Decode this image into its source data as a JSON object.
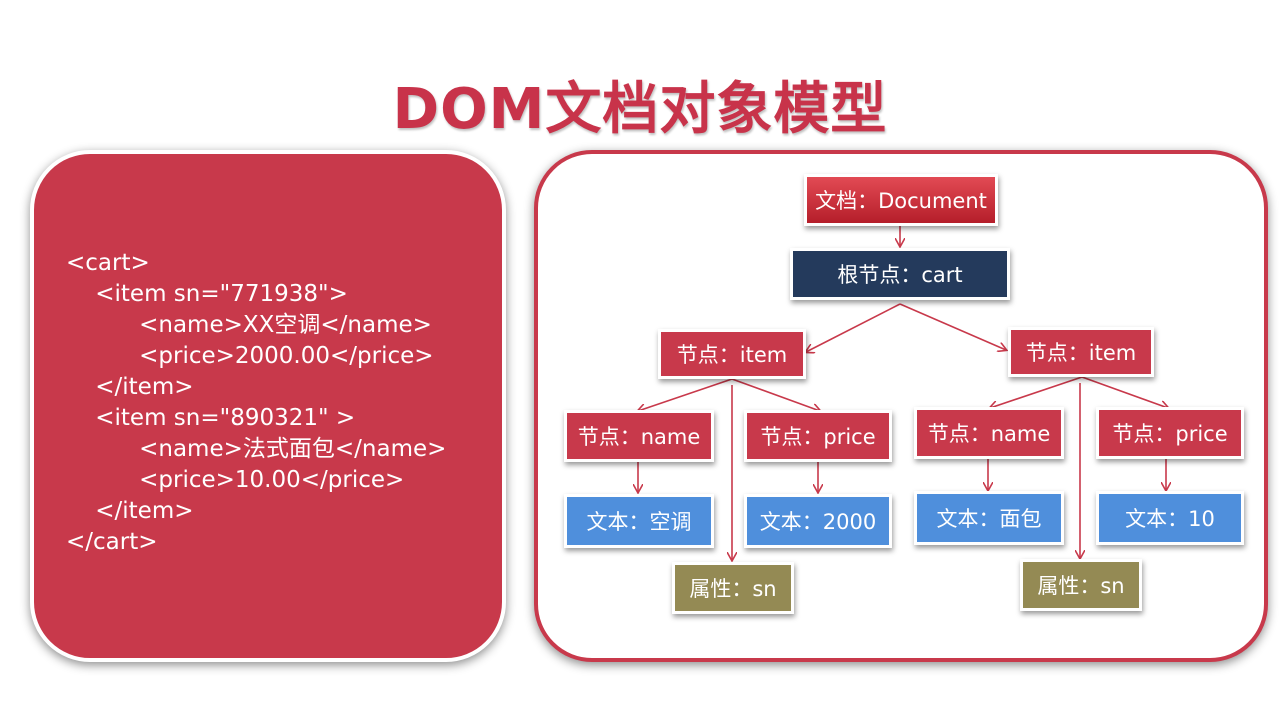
{
  "title": "DOM文档对象模型",
  "xml_lines": [
    "<cart>",
    "    <item sn=\"771938\">",
    "          <name>XX空调</name>",
    "          <price>2000.00</price>",
    "    </item>",
    "    <item sn=\"890321\" >",
    "          <name>法式面包</name>",
    "          <price>10.00</price>",
    "    </item>",
    "</cart>"
  ],
  "tree": {
    "document": "文档：Document",
    "root": "根节点：cart",
    "item1": {
      "label": "节点：item",
      "name": "节点：name",
      "price": "节点：price",
      "name_text": "文本：空调",
      "price_text": "文本：2000",
      "attr": "属性：sn"
    },
    "item2": {
      "label": "节点：item",
      "name": "节点：name",
      "price": "节点：price",
      "name_text": "文本：面包",
      "price_text": "文本：10",
      "attr": "属性：sn"
    }
  },
  "colors": {
    "accent": "#c8394b",
    "root": "#243a5c",
    "text_node": "#4f8fdc",
    "attr_node": "#948a54"
  }
}
